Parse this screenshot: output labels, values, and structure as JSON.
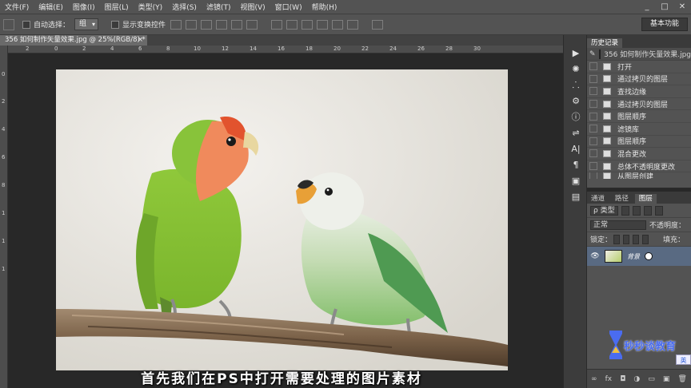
{
  "menubar": {
    "items": [
      "文件(F)",
      "编辑(E)",
      "图像(I)",
      "图层(L)",
      "类型(Y)",
      "选择(S)",
      "滤镜(T)",
      "视图(V)",
      "窗口(W)",
      "帮助(H)"
    ],
    "window_controls": [
      "_",
      "□",
      "✕"
    ]
  },
  "options": {
    "auto_select_label": "自动选择：",
    "auto_select_value": "组",
    "show_transform_label": "显示变换控件",
    "workspace_label": "基本功能"
  },
  "document": {
    "tab_title": "356 如何制作矢量效果.jpg @ 25%(RGB/8) *",
    "close": "×"
  },
  "ruler": {
    "h_ticks": [
      "2",
      "0",
      "2",
      "4",
      "6",
      "8",
      "10",
      "12",
      "14",
      "16",
      "18",
      "20",
      "22",
      "24",
      "26",
      "28",
      "30"
    ],
    "v_ticks": [
      "0",
      "2",
      "4",
      "6",
      "8",
      "1",
      "1",
      "1"
    ]
  },
  "subtitle": "首先我们在PS中打开需要处理的图片素材",
  "history": {
    "tab_label": "历史记录",
    "source_label": "356 如何制作矢量效果.jpg",
    "items": [
      "打开",
      "通过拷贝的图层",
      "查找边缘",
      "通过拷贝的图层",
      "图层顺序",
      "滤镜库",
      "图层顺序",
      "混合更改",
      "总体不透明度更改",
      "从图层创建"
    ]
  },
  "layers": {
    "tabs": [
      "通道",
      "路径",
      "图层"
    ],
    "filter_label": "ρ 类型",
    "blend_mode": "正常",
    "opacity_label": "不透明度：",
    "lock_label": "锁定：",
    "fill_label": "填充：",
    "layer_name": "背景",
    "footer_icons": [
      "∞",
      "fx",
      "◘",
      "◑",
      "▭",
      "▣",
      "🗑"
    ]
  },
  "watermark": {
    "text": "秒秒谈教育",
    "ime_label": "英"
  },
  "tool_icons": [
    "▶",
    "✺",
    "⸫",
    "⚙",
    "ⓘ",
    "⇌",
    "A|",
    "¶",
    "▣",
    "▤"
  ],
  "colors": {
    "chrome": "#535353",
    "canvas_bg": "#282828",
    "layer_selected": "#596a82"
  }
}
